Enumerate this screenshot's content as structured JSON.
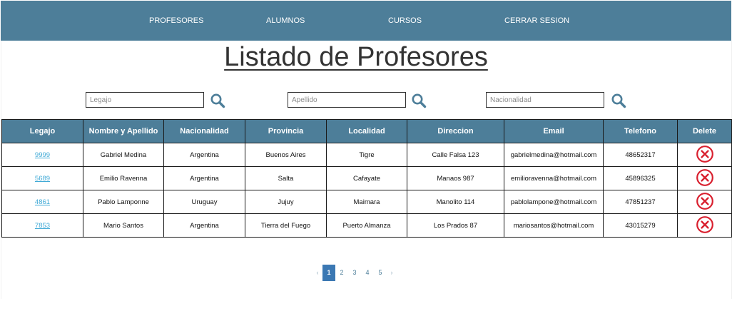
{
  "nav": {
    "items": [
      {
        "label": "PROFESORES"
      },
      {
        "label": "ALUMNOS"
      },
      {
        "label": "CURSOS"
      },
      {
        "label": "CERRAR SESION"
      }
    ]
  },
  "page": {
    "title": "Listado de Profesores"
  },
  "filters": {
    "legajo_placeholder": "Legajo",
    "apellido_placeholder": "Apellido",
    "nacionalidad_placeholder": "Nacionalidad",
    "search_icon": "magnifier-icon"
  },
  "colors": {
    "primary": "#4d7e99",
    "link": "#3fa9d6",
    "delete": "#d9202f",
    "active_page": "#3b78b3"
  },
  "table": {
    "headers": [
      "Legajo",
      "Nombre y Apellido",
      "Nacionalidad",
      "Provincia",
      "Localidad",
      "Direccion",
      "Email",
      "Telefono",
      "Delete"
    ],
    "rows": [
      {
        "legajo": "9999",
        "nombre": "Gabriel Medina",
        "nacionalidad": "Argentina",
        "provincia": "Buenos Aires",
        "localidad": "Tigre",
        "direccion": "Calle Falsa 123",
        "email": "gabrielmedina@hotmail.com",
        "telefono": "48652317"
      },
      {
        "legajo": "5689",
        "nombre": "Emilio Ravenna",
        "nacionalidad": "Argentina",
        "provincia": "Salta",
        "localidad": "Cafayate",
        "direccion": "Manaos 987",
        "email": "emilioravenna@hotmail.com",
        "telefono": "45896325"
      },
      {
        "legajo": "4861",
        "nombre": "Pablo Lamponne",
        "nacionalidad": "Uruguay",
        "provincia": "Jujuy",
        "localidad": "Maimara",
        "direccion": "Manolito 114",
        "email": "pablolampone@hotmail.com",
        "telefono": "47851237"
      },
      {
        "legajo": "7853",
        "nombre": "Mario Santos",
        "nacionalidad": "Argentina",
        "provincia": "Tierra del Fuego",
        "localidad": "Puerto Almanza",
        "direccion": "Los Prados 87",
        "email": "mariosantos@hotmail.com",
        "telefono": "43015279"
      }
    ],
    "delete_icon": "circle-x-icon"
  },
  "pagination": {
    "prev": "‹",
    "next": "›",
    "pages": [
      "1",
      "2",
      "3",
      "4",
      "5"
    ],
    "current": "1"
  }
}
